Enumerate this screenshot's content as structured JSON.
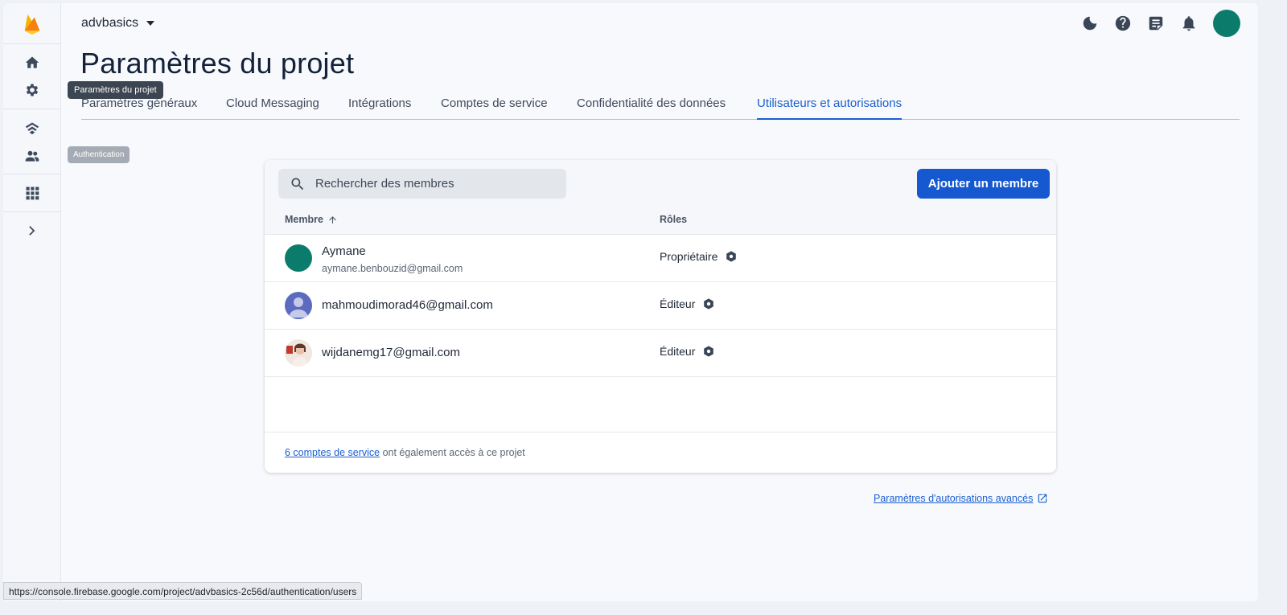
{
  "project": {
    "name": "advbasics"
  },
  "page": {
    "title": "Paramètres du projet"
  },
  "rail": {
    "tooltip_settings": "Paramètres du projet",
    "tooltip_auth": "Authentication",
    "icons": [
      "home-icon",
      "gear-icon",
      "realtime-db-icon",
      "users-icon",
      "apps-grid-icon",
      "chevron-right-icon"
    ]
  },
  "topbar": {
    "icons": [
      "dark-mode-icon",
      "help-icon",
      "notes-icon",
      "bell-icon",
      "avatar"
    ]
  },
  "tabs": [
    {
      "label": "Paramètres généraux"
    },
    {
      "label": "Cloud Messaging"
    },
    {
      "label": "Intégrations"
    },
    {
      "label": "Comptes de service"
    },
    {
      "label": "Confidentialité des données"
    },
    {
      "label": "Utilisateurs et autorisations",
      "active": true
    }
  ],
  "members": {
    "search_placeholder": "Rechercher des membres",
    "add_button": "Ajouter un membre",
    "col_member": "Membre",
    "col_roles": "Rôles",
    "rows": [
      {
        "name": "Aymane",
        "email": "aymane.benbouzid@gmail.com",
        "role": "Propriétaire",
        "avatar": "teal"
      },
      {
        "name": "mahmoudimorad46@gmail.com",
        "email": "",
        "role": "Éditeur",
        "avatar": "default"
      },
      {
        "name": "wijdanemg17@gmail.com",
        "email": "",
        "role": "Éditeur",
        "avatar": "photo"
      }
    ],
    "footer_link": "6 comptes de service",
    "footer_text": " ont également accès à ce projet"
  },
  "advanced_link": "Paramètres d'autorisations avancés",
  "status_url": "https://console.firebase.google.com/project/advbasics-2c56d/authentication/users",
  "colors": {
    "accent": "#1a5fd1",
    "button": "#1658d0",
    "avatar_teal": "#0b7b6b",
    "avatar_default": "#5c6bc0"
  }
}
